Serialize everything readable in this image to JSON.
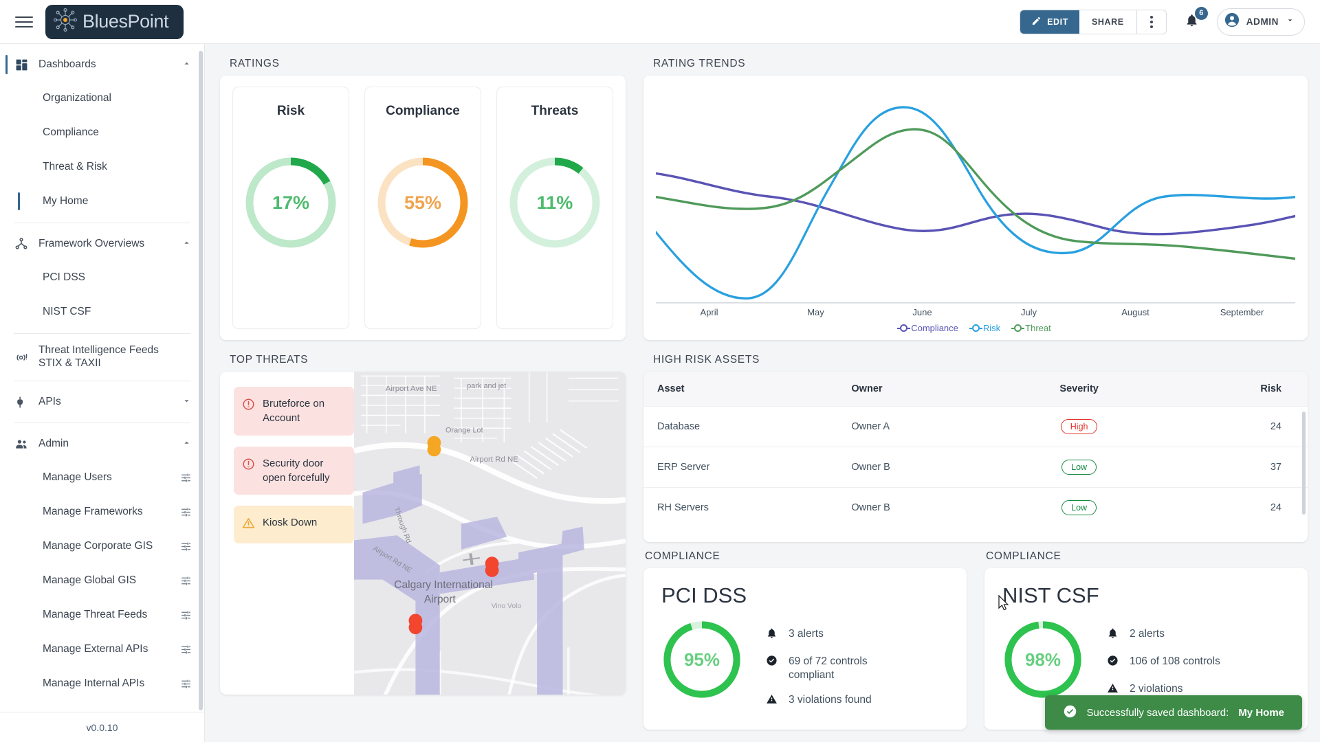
{
  "app": {
    "logo_text": "BluesPoint",
    "logo_icon": "network-atom-icon",
    "version": "v0.0.10"
  },
  "topbar": {
    "menu_icon": "hamburger-icon",
    "edit_label": "EDIT",
    "edit_icon": "pencil-icon",
    "share_label": "SHARE",
    "more_icon": "kebab-menu-icon",
    "bell_icon": "bell-icon",
    "notification_count": "6",
    "user_name": "ADMIN",
    "user_icon": "account-circle-icon",
    "user_caret": "chevron-down-icon",
    "accent": "#35678f"
  },
  "sidebar": {
    "groups": [
      {
        "label": "Dashboards",
        "icon": "dashboard-grid-icon",
        "expanded": true,
        "active": true,
        "items": [
          {
            "label": "Organizational",
            "selected": false
          },
          {
            "label": "Compliance",
            "selected": false
          },
          {
            "label": "Threat & Risk",
            "selected": false
          },
          {
            "label": "My Home",
            "selected": true
          }
        ]
      },
      {
        "label": "Framework Overviews",
        "icon": "hierarchy-icon",
        "expanded": true,
        "active": false,
        "items": [
          {
            "label": "PCI DSS",
            "selected": false
          },
          {
            "label": "NIST CSF",
            "selected": false
          }
        ]
      },
      {
        "label": "Threat Intelligence Feeds",
        "sublabel": "STIX & TAXII",
        "icon": "radar-signal-icon",
        "expanded": false,
        "active": false,
        "items": []
      },
      {
        "label": "APIs",
        "icon": "plug-icon",
        "expanded": false,
        "active": false,
        "items": []
      },
      {
        "label": "Admin",
        "icon": "people-icon",
        "expanded": true,
        "active": false,
        "items": [
          {
            "label": "Manage Users",
            "gear": "tune-settings-icon"
          },
          {
            "label": "Manage Frameworks",
            "gear": "tune-settings-icon"
          },
          {
            "label": "Manage Corporate GIS",
            "gear": "tune-settings-icon"
          },
          {
            "label": "Manage Global GIS",
            "gear": "tune-settings-icon"
          },
          {
            "label": "Manage Threat Feeds",
            "gear": "tune-settings-icon"
          },
          {
            "label": "Manage External APIs",
            "gear": "tune-settings-icon"
          },
          {
            "label": "Manage Internal APIs",
            "gear": "tune-settings-icon"
          }
        ]
      }
    ]
  },
  "ratings": {
    "title": "RATINGS",
    "gauges": [
      {
        "label": "Risk",
        "value": 17,
        "display": "17%",
        "color": "#21a84a",
        "track": "#bde8c9"
      },
      {
        "label": "Compliance",
        "value": 55,
        "display": "55%",
        "color": "#f59521",
        "track": "#fbe2c3"
      },
      {
        "label": "Threats",
        "value": 11,
        "display": "11%",
        "color": "#21a84a",
        "track": "#d3f0dc"
      }
    ]
  },
  "trends": {
    "title": "RATING TRENDS"
  },
  "chart_data": {
    "type": "line",
    "title": "RATING TRENDS",
    "xlabel": "",
    "ylabel": "",
    "grid": false,
    "legend_position": "bottom",
    "categories": [
      "April",
      "May",
      "June",
      "July",
      "August",
      "September"
    ],
    "x_tick_labels": [
      "April",
      "May",
      "June",
      "July",
      "August",
      "September"
    ],
    "ylim": [
      0,
      100
    ],
    "series": [
      {
        "name": "Compliance",
        "color": "#5a53b5",
        "values": [
          60,
          52,
          40,
          36,
          44,
          40,
          48
        ]
      },
      {
        "name": "Risk",
        "color": "#28a0e0",
        "values": [
          36,
          12,
          40,
          92,
          60,
          42,
          58
        ]
      },
      {
        "name": "Threat",
        "color": "#4f9a5a",
        "values": [
          54,
          46,
          56,
          80,
          52,
          40,
          28
        ]
      }
    ]
  },
  "top_threats": {
    "title": "TOP THREATS",
    "items": [
      {
        "text": "Bruteforce on Account",
        "severity": "error",
        "icon": "error-circle-icon"
      },
      {
        "text": "Security door open forcefully",
        "severity": "error",
        "icon": "error-circle-icon"
      },
      {
        "text": "Kiosk Down",
        "severity": "warning",
        "icon": "warning-triangle-icon"
      }
    ],
    "map": {
      "place": "Calgary International\nAirport",
      "labels": [
        "Airport Ave NE",
        "park and jet",
        "Orange Lot",
        "Airport Rd NE",
        "Through Rd",
        "Airport Rd NE",
        "Vino Volo"
      ],
      "markers": [
        {
          "color": "#f5a623",
          "type": "warning-marker"
        },
        {
          "color": "#f2462f",
          "type": "error-marker"
        },
        {
          "color": "#f2462f",
          "type": "error-marker"
        }
      ]
    }
  },
  "high_risk_assets": {
    "title": "HIGH RISK ASSETS",
    "columns": [
      "Asset",
      "Owner",
      "Severity",
      "Risk"
    ],
    "rows": [
      {
        "asset": "Database",
        "owner": "Owner A",
        "severity": "High",
        "severity_level": "high",
        "risk": "24"
      },
      {
        "asset": "ERP Server",
        "owner": "Owner B",
        "severity": "Low",
        "severity_level": "low",
        "risk": "37"
      },
      {
        "asset": "RH Servers",
        "owner": "Owner B",
        "severity": "Low",
        "severity_level": "low",
        "risk": "24"
      }
    ]
  },
  "compliance_panels": [
    {
      "title": "COMPLIANCE",
      "name": "PCI DSS",
      "percent": 95,
      "percent_display": "95%",
      "color": "#2ec24f",
      "stats": [
        {
          "icon": "bell-icon",
          "text": "3 alerts"
        },
        {
          "icon": "check-circle-icon",
          "text": "69 of 72 controls compliant"
        },
        {
          "icon": "warning-triangle-icon",
          "text": "3 violations found"
        }
      ]
    },
    {
      "title": "COMPLIANCE",
      "name": "NIST CSF",
      "percent": 98,
      "percent_display": "98%",
      "color": "#2ec24f",
      "stats": [
        {
          "icon": "bell-icon",
          "text": "2 alerts"
        },
        {
          "icon": "check-circle-icon",
          "text": "106 of 108 controls"
        },
        {
          "icon": "warning-triangle-icon",
          "text": "2 violations"
        }
      ]
    }
  ],
  "toast": {
    "icon": "check-circle-icon",
    "message": "Successfully saved dashboard:",
    "highlight": "My Home",
    "color": "#3d8b47"
  }
}
